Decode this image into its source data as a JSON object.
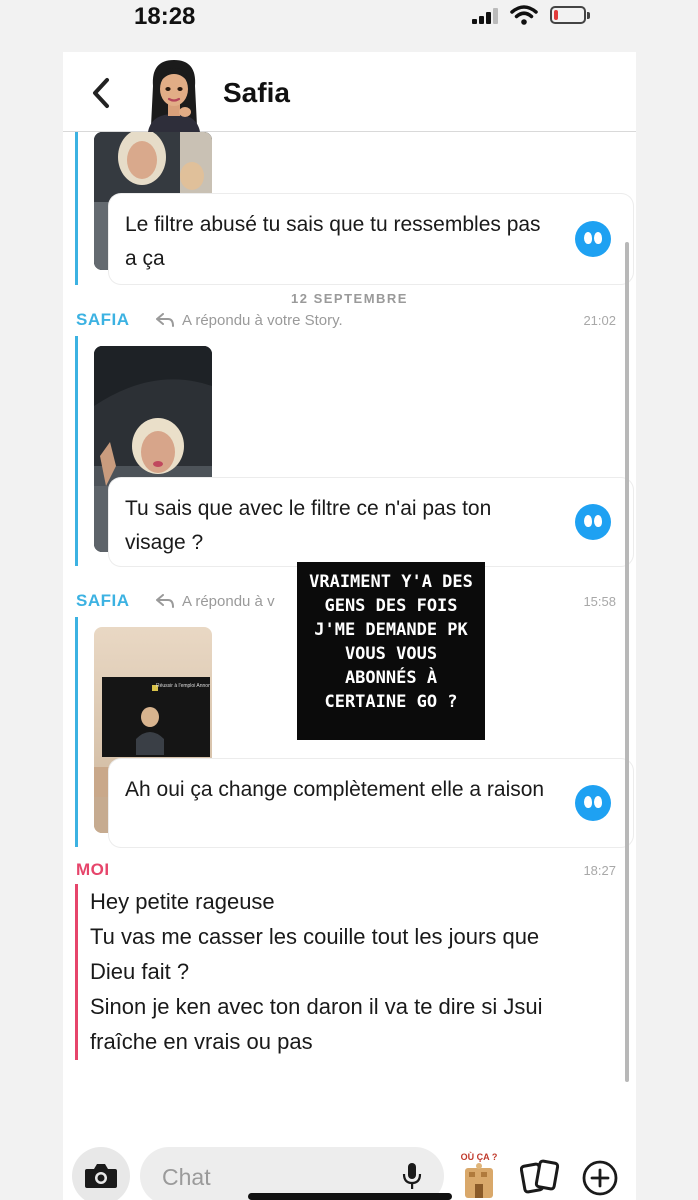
{
  "status_bar": {
    "time": "18:28"
  },
  "header": {
    "contact_name": "Safia",
    "back_icon": "chevron-left-icon",
    "avatar_icon": "bitmoji-avatar"
  },
  "messages": {
    "first_quote": "Le filtre abusé tu sais que tu ressembles pas a ça",
    "date_separator": "12 SEPTEMBRE",
    "reply_1": {
      "sender": "SAFIA",
      "reply_label": "A répondu à votre Story.",
      "time": "21:02",
      "quote": "Tu sais que avec le filtre ce n'ai pas ton visage ?"
    },
    "reply_2": {
      "sender": "SAFIA",
      "reply_label": "A répondu à v",
      "time": "15:58",
      "quote": "Ah oui ça change complètement elle a raison",
      "thumb_caption": "Réussir à l'emploi Annonk..."
    },
    "moi": {
      "sender": "MOI",
      "time": "18:27",
      "lines": [
        "Hey petite rageuse",
        "Tu vas me casser les couille tout les jours que",
        "Dieu fait ?",
        "Sinon je ken avec ton daron il va te dire si Jsui",
        "fraîche en vrais ou pas"
      ]
    }
  },
  "overlay_text": "VRAIMENT Y'A DES GENS DES FOIS J'ME DEMANDE PK VOUS VOUS ABONNÉS À CERTAINE GO ?",
  "composer": {
    "placeholder": "Chat",
    "sticker_label": "OÙ ÇA ?",
    "icons": [
      "camera-icon",
      "microphone-icon",
      "sticker-icon",
      "cards-icon",
      "plus-icon"
    ]
  },
  "colors": {
    "safia_blue": "#3cb2e2",
    "moi_pink": "#e6456b",
    "quote_button_blue": "#1ea1f2"
  }
}
